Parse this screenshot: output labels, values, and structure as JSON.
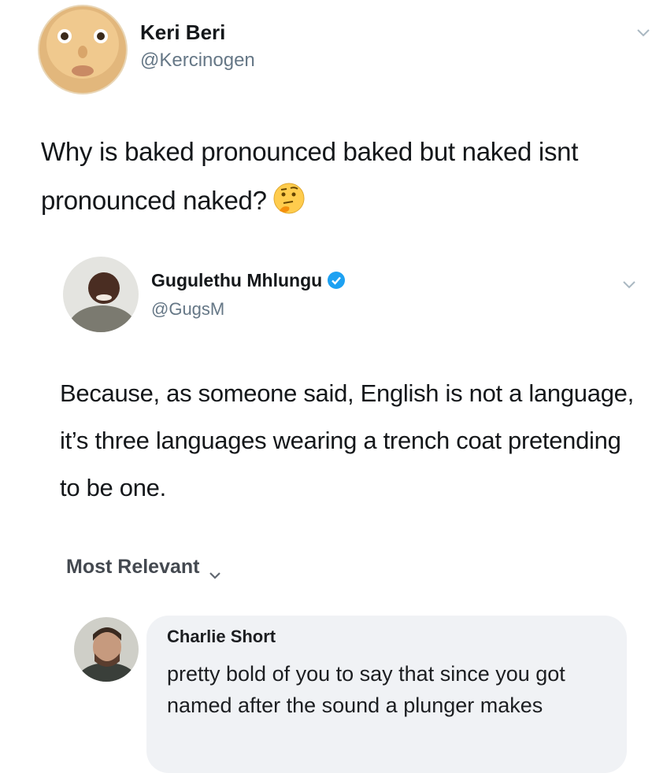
{
  "tweet1": {
    "author_name": "Keri Beri",
    "author_handle": "@Kercinogen",
    "text": "Why is baked pronounced baked but naked isnt pronounced naked?",
    "emoji": "thinking-face-icon"
  },
  "tweet2": {
    "author_name": "Gugulethu Mhlungu",
    "author_handle": "@GugsM",
    "verified": true,
    "text": "Because, as someone said, English is not a language, it’s three languages wearing a trench coat pretending to be one."
  },
  "comments": {
    "sort_label": "Most Relevant",
    "items": [
      {
        "author_name": "Charlie Short",
        "text": "pretty bold of you to say that since you got named after the sound a plunger makes"
      }
    ]
  },
  "colors": {
    "text_primary": "#14171a",
    "text_secondary": "#657786",
    "verified_blue": "#1da1f2",
    "bubble_bg": "#f0f2f5"
  }
}
